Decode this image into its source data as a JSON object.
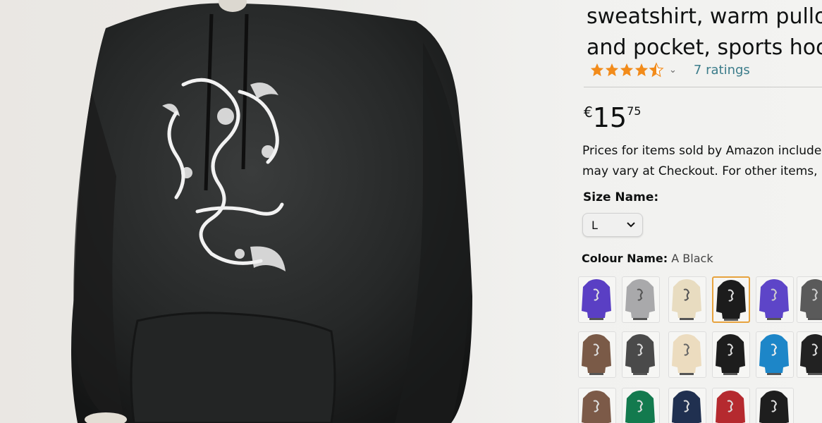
{
  "product": {
    "title_lines": [
      "sweatshirt, warm pullov",
      "and pocket, sports hood"
    ],
    "rating_value": 4.5,
    "ratings_count_text": "7 ratings",
    "price": {
      "currency": "€",
      "whole": "15",
      "fraction": "75"
    },
    "price_note_lines": [
      "Prices for items sold by Amazon include V",
      "may vary at Checkout. For other items, ple"
    ],
    "size": {
      "label": "Size Name:",
      "selected": "L"
    },
    "colour": {
      "label": "Colour Name:",
      "selected": "A Black"
    },
    "colour_swatches": [
      {
        "name": "purple-dragon",
        "color": "#5a3fc4",
        "print": "#ddd"
      },
      {
        "name": "grey-dragon",
        "color": "#a9a9ab",
        "print": "#555"
      },
      {
        "name": "cream-dragon",
        "color": "#e8dcc0",
        "print": "#555"
      },
      {
        "name": "black-dragon",
        "color": "#1c1c1c",
        "print": "#ddd",
        "selected": true
      },
      {
        "name": "violet-dragon",
        "color": "#5d45c8",
        "print": "#ccc"
      },
      {
        "name": "charcoal-dragon",
        "color": "#5a5a5a",
        "print": "#ccc"
      },
      {
        "name": "brown-text",
        "color": "#7a5a47",
        "print": "#ddd"
      },
      {
        "name": "dark-grey-text",
        "color": "#4a4a4a",
        "print": "#ddd"
      },
      {
        "name": "cream-text",
        "color": "#ecdcbf",
        "print": "#666"
      },
      {
        "name": "black-text",
        "color": "#1d1d1d",
        "print": "#ddd"
      },
      {
        "name": "blue-text",
        "color": "#1d86c8",
        "print": "#eee"
      },
      {
        "name": "black-text-2",
        "color": "#222",
        "print": "#ddd"
      },
      {
        "name": "brown-2",
        "color": "#7c5a48",
        "print": "#ddd"
      },
      {
        "name": "green",
        "color": "#137a4e",
        "print": "#ddd"
      },
      {
        "name": "navy",
        "color": "#203050",
        "print": "#ddd"
      },
      {
        "name": "red",
        "color": "#b52a2f",
        "print": "#ddd"
      },
      {
        "name": "black-3",
        "color": "#1e1e1e",
        "print": "#ddd"
      }
    ]
  },
  "colors": {
    "star": "#f28b1a",
    "link": "#3b7c8a",
    "selected_border": "#e7a33e"
  }
}
